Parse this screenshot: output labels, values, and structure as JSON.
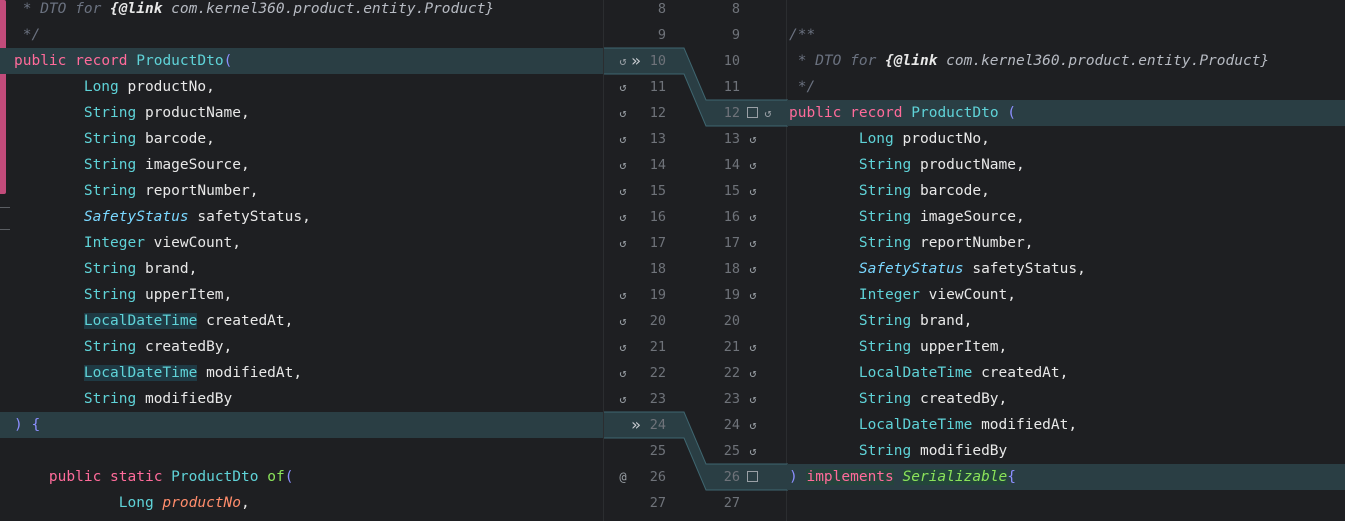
{
  "left": {
    "lines": [
      [
        [
          "comment",
          " * DTO for "
        ],
        [
          "doc-tag",
          "{@link"
        ],
        [
          "doc-ref",
          " com.kernel360.product.entity.Product}"
        ]
      ],
      [
        [
          "comment",
          " */"
        ]
      ],
      [
        [
          "kw",
          "public"
        ],
        [
          "ident",
          " "
        ],
        [
          "kw",
          "record"
        ],
        [
          "ident",
          " "
        ],
        [
          "type",
          "ProductDto"
        ],
        [
          "punct",
          "("
        ]
      ],
      [
        [
          "ident",
          "        "
        ],
        [
          "type",
          "Long"
        ],
        [
          "ident",
          " productNo,"
        ]
      ],
      [
        [
          "ident",
          "        "
        ],
        [
          "type",
          "String"
        ],
        [
          "ident",
          " productName,"
        ]
      ],
      [
        [
          "ident",
          "        "
        ],
        [
          "type",
          "String"
        ],
        [
          "ident",
          " barcode,"
        ]
      ],
      [
        [
          "ident",
          "        "
        ],
        [
          "type",
          "String"
        ],
        [
          "ident",
          " imageSource,"
        ]
      ],
      [
        [
          "ident",
          "        "
        ],
        [
          "type",
          "String"
        ],
        [
          "ident",
          " reportNumber,"
        ]
      ],
      [
        [
          "ident",
          "        "
        ],
        [
          "safety",
          "SafetyStatus"
        ],
        [
          "ident",
          " safetyStatus,"
        ]
      ],
      [
        [
          "ident",
          "        "
        ],
        [
          "type",
          "Integer"
        ],
        [
          "ident",
          " viewCount,"
        ]
      ],
      [
        [
          "ident",
          "        "
        ],
        [
          "type",
          "String"
        ],
        [
          "ident",
          " brand,"
        ]
      ],
      [
        [
          "ident",
          "        "
        ],
        [
          "type",
          "String"
        ],
        [
          "ident",
          " upperItem,"
        ]
      ],
      [
        [
          "ident",
          "        "
        ],
        [
          "ldt",
          "LocalDateTime"
        ],
        [
          "ident",
          " createdAt,"
        ]
      ],
      [
        [
          "ident",
          "        "
        ],
        [
          "type",
          "String"
        ],
        [
          "ident",
          " createdBy,"
        ]
      ],
      [
        [
          "ident",
          "        "
        ],
        [
          "ldt",
          "LocalDateTime"
        ],
        [
          "ident",
          " modifiedAt,"
        ]
      ],
      [
        [
          "ident",
          "        "
        ],
        [
          "type",
          "String"
        ],
        [
          "ident",
          " modifiedBy"
        ]
      ],
      [
        [
          "punct",
          ")"
        ],
        [
          "ident",
          " "
        ],
        [
          "punct",
          "{"
        ]
      ],
      [
        [
          "ident",
          ""
        ]
      ],
      [
        [
          "ident",
          "    "
        ],
        [
          "kw",
          "public"
        ],
        [
          "ident",
          " "
        ],
        [
          "kw",
          "static"
        ],
        [
          "ident",
          " "
        ],
        [
          "type",
          "ProductDto"
        ],
        [
          "ident",
          " "
        ],
        [
          "method",
          "of"
        ],
        [
          "punct",
          "("
        ]
      ],
      [
        [
          "ident",
          "            "
        ],
        [
          "type",
          "Long"
        ],
        [
          "ident",
          " "
        ],
        [
          "param",
          "productNo"
        ],
        [
          "ident",
          ","
        ]
      ]
    ],
    "highlighted": [
      2,
      16
    ]
  },
  "right": {
    "lines": [
      [
        [
          "ident",
          ""
        ]
      ],
      [
        [
          "comment",
          "/**"
        ]
      ],
      [
        [
          "comment",
          " * DTO for "
        ],
        [
          "doc-tag",
          "{@link"
        ],
        [
          "doc-ref",
          " com.kernel360.product.entity.Product}"
        ]
      ],
      [
        [
          "comment",
          " */"
        ]
      ],
      [
        [
          "kw",
          "public"
        ],
        [
          "ident",
          " "
        ],
        [
          "kw",
          "record"
        ],
        [
          "ident",
          " "
        ],
        [
          "type",
          "ProductDto"
        ],
        [
          "ident",
          " "
        ],
        [
          "punct",
          "("
        ]
      ],
      [
        [
          "ident",
          "        "
        ],
        [
          "type",
          "Long"
        ],
        [
          "ident",
          " productNo,"
        ]
      ],
      [
        [
          "ident",
          "        "
        ],
        [
          "type",
          "String"
        ],
        [
          "ident",
          " productName,"
        ]
      ],
      [
        [
          "ident",
          "        "
        ],
        [
          "type",
          "String"
        ],
        [
          "ident",
          " barcode,"
        ]
      ],
      [
        [
          "ident",
          "        "
        ],
        [
          "type",
          "String"
        ],
        [
          "ident",
          " imageSource,"
        ]
      ],
      [
        [
          "ident",
          "        "
        ],
        [
          "type",
          "String"
        ],
        [
          "ident",
          " reportNumber,"
        ]
      ],
      [
        [
          "ident",
          "        "
        ],
        [
          "safety",
          "SafetyStatus"
        ],
        [
          "ident",
          " safetyStatus,"
        ]
      ],
      [
        [
          "ident",
          "        "
        ],
        [
          "type",
          "Integer"
        ],
        [
          "ident",
          " viewCount,"
        ]
      ],
      [
        [
          "ident",
          "        "
        ],
        [
          "type",
          "String"
        ],
        [
          "ident",
          " brand,"
        ]
      ],
      [
        [
          "ident",
          "        "
        ],
        [
          "type",
          "String"
        ],
        [
          "ident",
          " upperItem,"
        ]
      ],
      [
        [
          "ident",
          "        "
        ],
        [
          "ldt-plain",
          "LocalDateTime"
        ],
        [
          "ident",
          " createdAt,"
        ]
      ],
      [
        [
          "ident",
          "        "
        ],
        [
          "type",
          "String"
        ],
        [
          "ident",
          " createdBy,"
        ]
      ],
      [
        [
          "ident",
          "        "
        ],
        [
          "ldt-plain",
          "LocalDateTime"
        ],
        [
          "ident",
          " modifiedAt,"
        ]
      ],
      [
        [
          "ident",
          "        "
        ],
        [
          "type",
          "String"
        ],
        [
          "ident",
          " modifiedBy"
        ]
      ],
      [
        [
          "punct",
          ")"
        ],
        [
          "ident",
          " "
        ],
        [
          "kw",
          "implements"
        ],
        [
          "ident",
          " "
        ],
        [
          "italic-type",
          "Serializable"
        ],
        [
          "punct",
          "{"
        ]
      ]
    ],
    "highlighted": [
      4,
      18
    ]
  },
  "gutter": {
    "left_numbers": [
      "8",
      "9",
      "10",
      "11",
      "12",
      "13",
      "14",
      "15",
      "16",
      "17",
      "18",
      "19",
      "20",
      "21",
      "22",
      "23",
      "24",
      "25",
      "26",
      "27"
    ],
    "right_numbers": [
      "8",
      "9",
      "10",
      "11",
      "12",
      "13",
      "14",
      "15",
      "16",
      "17",
      "18",
      "19",
      "20",
      "21",
      "22",
      "23",
      "24",
      "25",
      "26",
      "27"
    ],
    "left_marks": [
      "",
      "",
      "↺",
      "↺",
      "↺",
      "↺",
      "↺",
      "↺",
      "↺",
      "↺",
      "",
      "↺",
      "↺",
      "↺",
      "↺",
      "↺",
      "",
      "",
      "@",
      ""
    ],
    "right_marks": [
      "",
      "",
      "",
      "",
      "↺",
      "↺",
      "↺",
      "↺",
      "↺",
      "↺",
      "↺",
      "↺",
      "",
      "↺",
      "↺",
      "↺",
      "↺",
      "↺",
      "",
      ""
    ],
    "chevron": "»",
    "checkbox_rows": [
      4,
      18
    ]
  }
}
